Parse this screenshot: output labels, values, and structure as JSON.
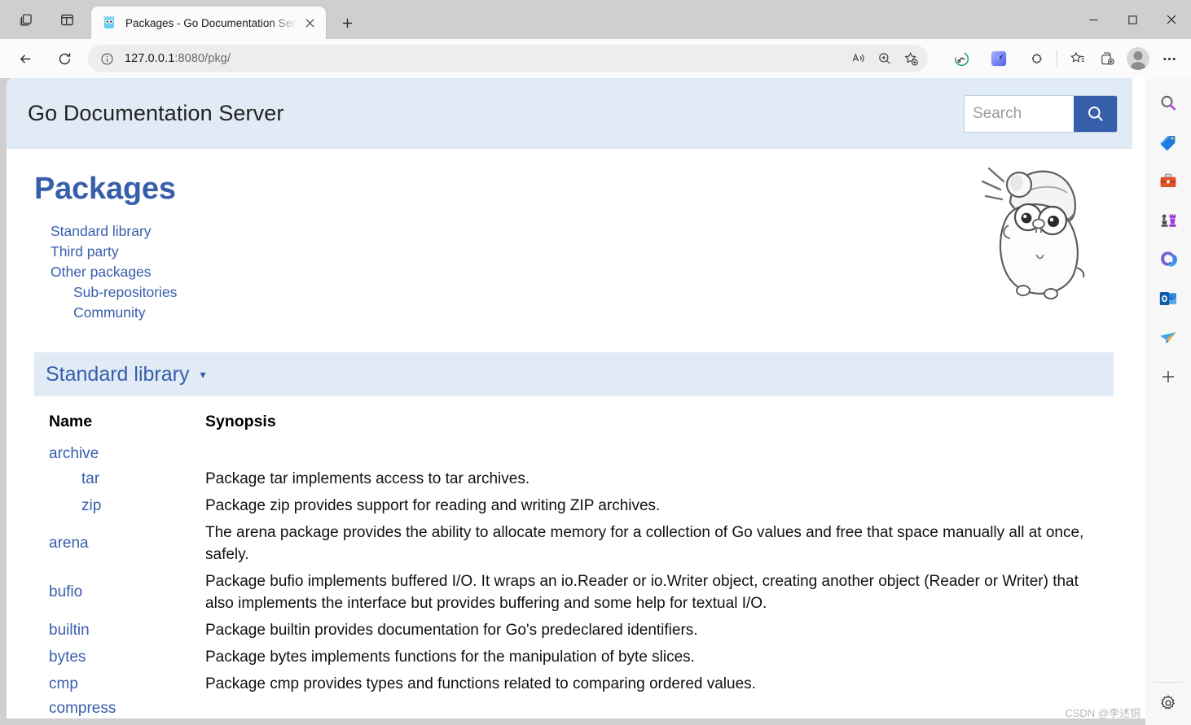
{
  "window": {
    "tab_actions_icon": "tab-stack-icon",
    "split_pane_icon": "split-screen-icon",
    "tab": {
      "favicon": "go-gopher-favicon",
      "title": "Packages - Go Documentation Ser",
      "close_icon": "close-icon"
    },
    "new_tab_icon": "plus-icon",
    "controls": {
      "minimize": "minimize-icon",
      "maximize": "maximize-icon",
      "close": "close-icon"
    }
  },
  "toolbar": {
    "back_icon": "back-arrow-icon",
    "refresh_icon": "refresh-icon",
    "site_info_icon": "info-circle-icon",
    "url": "127.0.0.1",
    "url_suffix": ":8080/pkg/",
    "url_full": "127.0.0.1:8080/pkg/",
    "read_aloud_icon": "read-aloud-icon",
    "zoom_icon": "zoom-magnifier-icon",
    "add_favorite_icon": "add-favorite-star-icon",
    "copilot_icon": "copilot-icon",
    "extension_blue_icon": "extension-icon",
    "extensions_icon": "extensions-puzzle-icon",
    "favorites_icon": "favorites-star-list-icon",
    "collections_icon": "collections-icon",
    "profile_icon": "profile-avatar",
    "settings_more_icon": "more-options-icon"
  },
  "sidebar": {
    "items": [
      {
        "name": "search-icon",
        "label": "Search"
      },
      {
        "name": "shopping-tag-icon",
        "label": "Shopping"
      },
      {
        "name": "tools-briefcase-icon",
        "label": "Tools"
      },
      {
        "name": "games-chess-icon",
        "label": "Games"
      },
      {
        "name": "microsoft-365-icon",
        "label": "Microsoft 365"
      },
      {
        "name": "outlook-icon",
        "label": "Outlook"
      },
      {
        "name": "send-plane-icon",
        "label": "Send"
      },
      {
        "name": "add-sidebar-icon",
        "label": "Customize"
      }
    ],
    "settings_icon": "gear-icon"
  },
  "page": {
    "header": {
      "title": "Go Documentation Server",
      "background": "#e0ebf5",
      "search": {
        "placeholder": "Search",
        "value": "",
        "button_icon": "search-icon",
        "button_color": "#375eab"
      }
    },
    "heading": "Packages",
    "heading_color": "#375eab",
    "toc": [
      {
        "label": "Standard library",
        "level": 1
      },
      {
        "label": "Third party",
        "level": 1
      },
      {
        "label": "Other packages",
        "level": 1
      },
      {
        "label": "Sub-repositories",
        "level": 2
      },
      {
        "label": "Community",
        "level": 2
      }
    ],
    "mascot": "go-gopher-sketch",
    "section_toggle": {
      "label": "Standard library",
      "caret": "▾",
      "background": "#e0ebf5"
    },
    "table": {
      "columns": [
        "Name",
        "Synopsis"
      ],
      "rows": [
        {
          "name": "archive",
          "indent": 0,
          "synopsis": ""
        },
        {
          "name": "tar",
          "indent": 1,
          "synopsis": "Package tar implements access to tar archives."
        },
        {
          "name": "zip",
          "indent": 1,
          "synopsis": "Package zip provides support for reading and writing ZIP archives."
        },
        {
          "name": "arena",
          "indent": 0,
          "synopsis": "The arena package provides the ability to allocate memory for a collection of Go values and free that space manually all at once, safely."
        },
        {
          "name": "bufio",
          "indent": 0,
          "synopsis": "Package bufio implements buffered I/O. It wraps an io.Reader or io.Writer object, creating another object (Reader or Writer) that also implements the interface but provides buffering and some help for textual I/O."
        },
        {
          "name": "builtin",
          "indent": 0,
          "synopsis": "Package builtin provides documentation for Go's predeclared identifiers."
        },
        {
          "name": "bytes",
          "indent": 0,
          "synopsis": "Package bytes implements functions for the manipulation of byte slices."
        },
        {
          "name": "cmp",
          "indent": 0,
          "synopsis": "Package cmp provides types and functions related to comparing ordered values."
        },
        {
          "name": "compress",
          "indent": 0,
          "synopsis": ""
        }
      ]
    },
    "scrollbar": {
      "up_arrow": "▲",
      "position": "top"
    }
  },
  "watermark": "CSDN @李述铜"
}
